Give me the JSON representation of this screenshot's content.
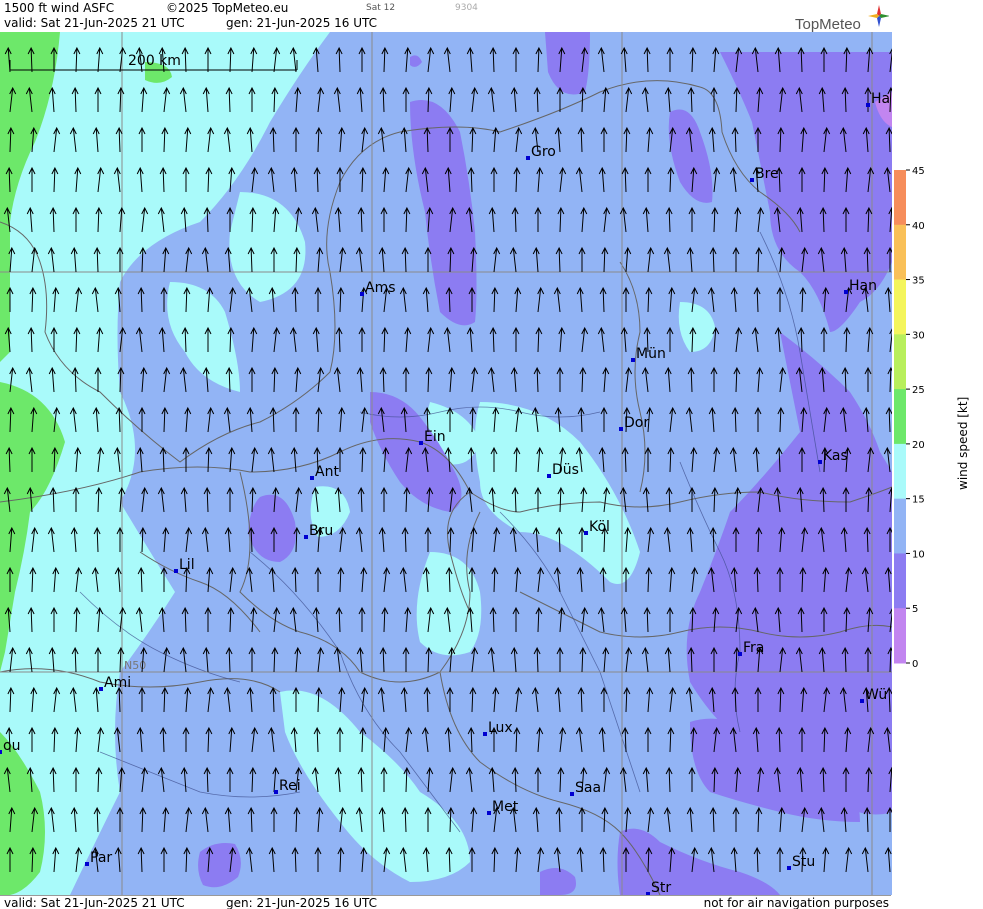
{
  "header": {
    "product": "1500 ft wind ASFC",
    "copyright": "©2025 TopMeteo.eu",
    "run_id": "Sat 12",
    "code": "9304",
    "valid": "valid:  Sat  21-Jun-2025  21 UTC",
    "gen": "gen: 21-Jun-2025 16 UTC",
    "logo": "TopMeteo"
  },
  "footer": {
    "valid": "valid:  Sat  21-Jun-2025  21 UTC",
    "gen": "gen: 21-Jun-2025 16 UTC",
    "disclaimer": "not for air navigation purposes"
  },
  "map": {
    "scale_label": "200 km",
    "grid_label": "N50",
    "wind_direction": "southerly",
    "cities": [
      {
        "name": "Gro"
      },
      {
        "name": "Bre"
      },
      {
        "name": "Ha"
      },
      {
        "name": "Ams"
      },
      {
        "name": "Han"
      },
      {
        "name": "Mün"
      },
      {
        "name": "Ein"
      },
      {
        "name": "Dor"
      },
      {
        "name": "Kas"
      },
      {
        "name": "Ant"
      },
      {
        "name": "Düs"
      },
      {
        "name": "Bru"
      },
      {
        "name": "Köl"
      },
      {
        "name": "Lil"
      },
      {
        "name": "Fra"
      },
      {
        "name": "Ami"
      },
      {
        "name": "Wü"
      },
      {
        "name": "Lux"
      },
      {
        "name": "ou"
      },
      {
        "name": "Rei"
      },
      {
        "name": "Saa"
      },
      {
        "name": "Met"
      },
      {
        "name": "Par"
      },
      {
        "name": "Stu"
      },
      {
        "name": "Str"
      }
    ]
  },
  "legend": {
    "title": "wind  speed  [kt]",
    "ticks": [
      "45",
      "40",
      "35",
      "30",
      "25",
      "20",
      "15",
      "10",
      "5",
      "0"
    ],
    "colors": {
      "0-5": "#c285f0",
      "5-10": "#8c7cf2",
      "10-15": "#92b4f5",
      "15-20": "#a9fafa",
      "20-25": "#6de86a",
      "25-30": "#b8ef5c",
      "30-35": "#f4f55c",
      "35-40": "#f9c058",
      "40-45": "#f68d5b"
    }
  }
}
